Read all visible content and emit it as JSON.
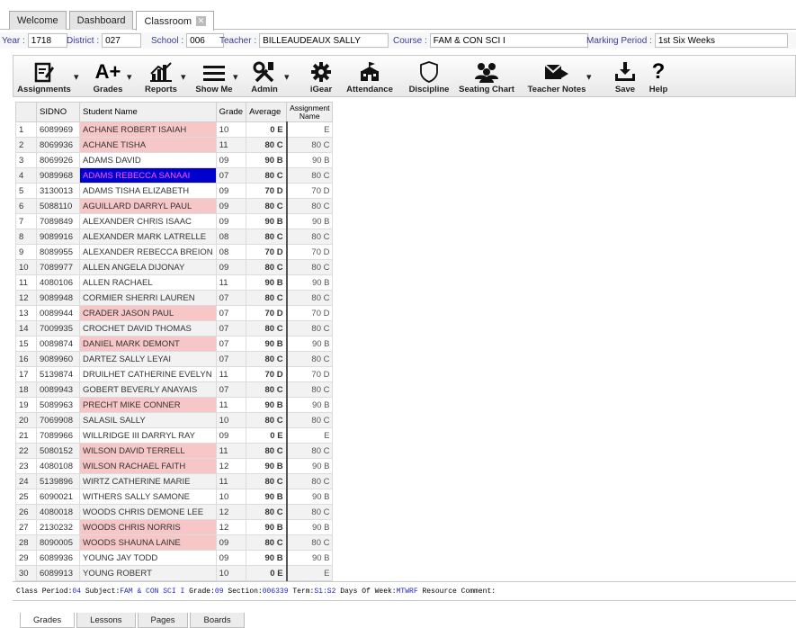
{
  "tabs": {
    "welcome": "Welcome",
    "dashboard": "Dashboard",
    "classroom": "Classroom"
  },
  "info": {
    "year_label": "Year :",
    "year": "1718",
    "district_label": "District :",
    "district": "027",
    "school_label": "School :",
    "school": "006",
    "teacher_label": "Teacher :",
    "teacher": "BILLEAUDEAUX SALLY",
    "course_label": "Course :",
    "course": "FAM & CON SCI I",
    "period_label": "Marking Period :",
    "period": "1st Six Weeks"
  },
  "toolbar": {
    "assignments": "Assignments",
    "grades": "Grades",
    "reports": "Reports",
    "showme": "Show Me",
    "admin": "Admin",
    "igear": "iGear",
    "attendance": "Attendance",
    "discipline": "Discipline",
    "seating": "Seating Chart",
    "notes": "Teacher Notes",
    "save": "Save",
    "help": "Help"
  },
  "grid": {
    "headers": {
      "sidno": "SIDNO",
      "name": "Student Name",
      "grade": "Grade",
      "average": "Average",
      "assignment_line1": "Assignment",
      "assignment_line2": "Name"
    },
    "rows": [
      {
        "n": "1",
        "sidno": "6089969",
        "name": "ACHANE ROBERT ISAIAH",
        "grade": "10",
        "avg": "0 E",
        "asg": "E",
        "hl": "pink"
      },
      {
        "n": "2",
        "sidno": "8069936",
        "name": "ACHANE TISHA",
        "grade": "11",
        "avg": "80 C",
        "asg": "80 C",
        "hl": "pink"
      },
      {
        "n": "3",
        "sidno": "8069926",
        "name": "ADAMS DAVID",
        "grade": "09",
        "avg": "90 B",
        "asg": "90 B",
        "hl": ""
      },
      {
        "n": "4",
        "sidno": "9089968",
        "name": "ADAMS REBECCA SANAAI",
        "grade": "07",
        "avg": "80 C",
        "asg": "80 C",
        "hl": "selected"
      },
      {
        "n": "5",
        "sidno": "3130013",
        "name": "ADAMS TISHA ELIZABETH",
        "grade": "09",
        "avg": "70 D",
        "asg": "70 D",
        "hl": ""
      },
      {
        "n": "6",
        "sidno": "5088110",
        "name": "AGUILLARD DARRYL PAUL",
        "grade": "09",
        "avg": "80 C",
        "asg": "80 C",
        "hl": "pink"
      },
      {
        "n": "7",
        "sidno": "7089849",
        "name": "ALEXANDER CHRIS ISAAC",
        "grade": "09",
        "avg": "90 B",
        "asg": "90 B",
        "hl": ""
      },
      {
        "n": "8",
        "sidno": "9089916",
        "name": "ALEXANDER MARK LATRELLE",
        "grade": "08",
        "avg": "80 C",
        "asg": "80 C",
        "hl": ""
      },
      {
        "n": "9",
        "sidno": "8089955",
        "name": "ALEXANDER REBECCA BREION",
        "grade": "08",
        "avg": "70 D",
        "asg": "70 D",
        "hl": ""
      },
      {
        "n": "10",
        "sidno": "7089977",
        "name": "ALLEN ANGELA DIJONAY",
        "grade": "09",
        "avg": "80 C",
        "asg": "80 C",
        "hl": ""
      },
      {
        "n": "11",
        "sidno": "4080106",
        "name": "ALLEN RACHAEL",
        "grade": "11",
        "avg": "90 B",
        "asg": "90 B",
        "hl": ""
      },
      {
        "n": "12",
        "sidno": "9089948",
        "name": "CORMIER SHERRI LAUREN",
        "grade": "07",
        "avg": "80 C",
        "asg": "80 C",
        "hl": ""
      },
      {
        "n": "13",
        "sidno": "0089944",
        "name": "CRADER JASON PAUL",
        "grade": "07",
        "avg": "70 D",
        "asg": "70 D",
        "hl": "pink"
      },
      {
        "n": "14",
        "sidno": "7009935",
        "name": "CROCHET DAVID THOMAS",
        "grade": "07",
        "avg": "80 C",
        "asg": "80 C",
        "hl": ""
      },
      {
        "n": "15",
        "sidno": "0089874",
        "name": "DANIEL MARK DEMONT",
        "grade": "07",
        "avg": "90 B",
        "asg": "90 B",
        "hl": "pink"
      },
      {
        "n": "16",
        "sidno": "9089960",
        "name": "DARTEZ SALLY LEYAI",
        "grade": "07",
        "avg": "80 C",
        "asg": "80 C",
        "hl": ""
      },
      {
        "n": "17",
        "sidno": "5139874",
        "name": "DRUILHET CATHERINE EVELYN",
        "grade": "11",
        "avg": "70 D",
        "asg": "70 D",
        "hl": ""
      },
      {
        "n": "18",
        "sidno": "0089943",
        "name": "GOBERT BEVERLY ANAYAIS",
        "grade": "07",
        "avg": "80 C",
        "asg": "80 C",
        "hl": ""
      },
      {
        "n": "19",
        "sidno": "5089963",
        "name": "PRECHT MIKE CONNER",
        "grade": "11",
        "avg": "90 B",
        "asg": "90 B",
        "hl": "pink"
      },
      {
        "n": "20",
        "sidno": "7069908",
        "name": "SALASIL SALLY",
        "grade": "10",
        "avg": "80 C",
        "asg": "80 C",
        "hl": ""
      },
      {
        "n": "21",
        "sidno": "7089966",
        "name": "WILLRIDGE III DARRYL RAY",
        "grade": "09",
        "avg": "0 E",
        "asg": "E",
        "hl": ""
      },
      {
        "n": "22",
        "sidno": "5080152",
        "name": "WILSON DAVID TERRELL",
        "grade": "11",
        "avg": "80 C",
        "asg": "80 C",
        "hl": "pink"
      },
      {
        "n": "23",
        "sidno": "4080108",
        "name": "WILSON RACHAEL FAITH",
        "grade": "12",
        "avg": "90 B",
        "asg": "90 B",
        "hl": "pink"
      },
      {
        "n": "24",
        "sidno": "5139896",
        "name": "WIRTZ CATHERINE MARIE",
        "grade": "11",
        "avg": "80 C",
        "asg": "80 C",
        "hl": ""
      },
      {
        "n": "25",
        "sidno": "6090021",
        "name": "WITHERS SALLY SAMONE",
        "grade": "10",
        "avg": "90 B",
        "asg": "90 B",
        "hl": ""
      },
      {
        "n": "26",
        "sidno": "4080018",
        "name": "WOODS CHRIS DEMONE LEE",
        "grade": "12",
        "avg": "80 C",
        "asg": "80 C",
        "hl": ""
      },
      {
        "n": "27",
        "sidno": "2130232",
        "name": "WOODS CHRIS NORRIS",
        "grade": "12",
        "avg": "90 B",
        "asg": "90 B",
        "hl": "pink"
      },
      {
        "n": "28",
        "sidno": "8090005",
        "name": "WOODS SHAUNA LAINE",
        "grade": "09",
        "avg": "80 C",
        "asg": "80 C",
        "hl": "pink"
      },
      {
        "n": "29",
        "sidno": "6089936",
        "name": "YOUNG JAY TODD",
        "grade": "09",
        "avg": "90 B",
        "asg": "90 B",
        "hl": ""
      },
      {
        "n": "30",
        "sidno": "6089913",
        "name": "YOUNG ROBERT",
        "grade": "10",
        "avg": "0 E",
        "asg": "E",
        "hl": ""
      }
    ]
  },
  "classline": {
    "period_label": "Class Period:",
    "period": "04",
    "subject_label": "Subject:",
    "subject": "FAM & CON SCI I",
    "grade_label": "Grade:",
    "grade": "09",
    "section_label": "Section:",
    "section": "006339",
    "term_label": "Term:",
    "term": "S1:S2",
    "days_label": "Days Of Week:",
    "days": "MTWRF",
    "resource_label": "Resource Comment:"
  },
  "bottom_tabs": [
    "Grades",
    "Lessons",
    "Pages",
    "Boards"
  ],
  "colors": {
    "pink": "#f7c6c6",
    "selected_bg": "#0000cc",
    "selected_text": "#ff55ff",
    "accent_text": "#2222cc"
  }
}
